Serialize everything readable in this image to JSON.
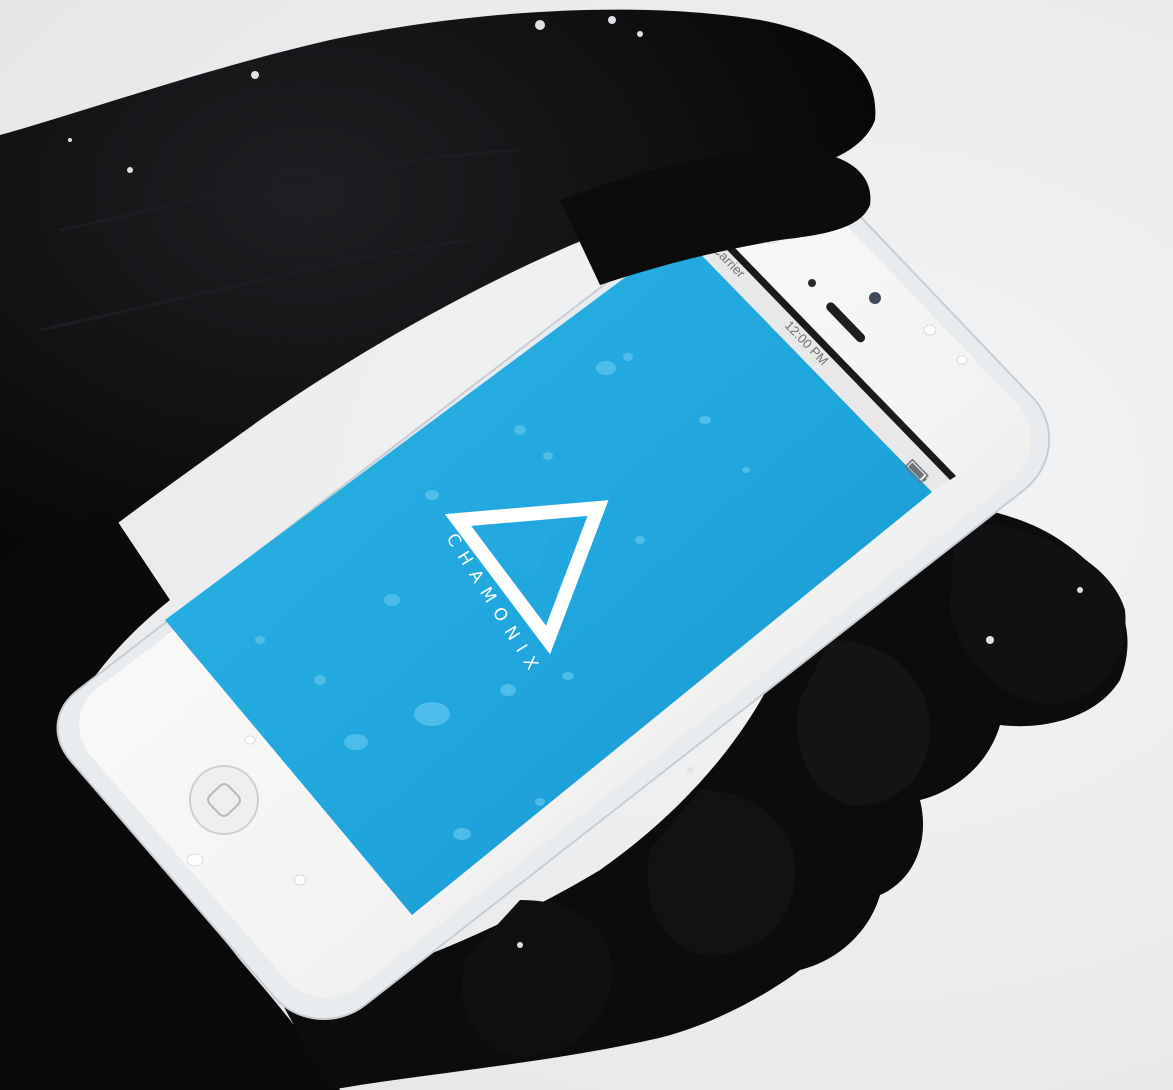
{
  "status_bar": {
    "carrier": "Carrier",
    "time": "12:00 PM"
  },
  "app": {
    "brand_name": "CHAMONIX",
    "logo_icon": "triangle-logo-icon"
  },
  "colors": {
    "screen_blue": "#1fa6dd",
    "screen_blue_dark": "#148fc6",
    "phone_white": "#f5f5f3",
    "glove_black": "#0b0b0c",
    "snow": "#eceef0"
  }
}
